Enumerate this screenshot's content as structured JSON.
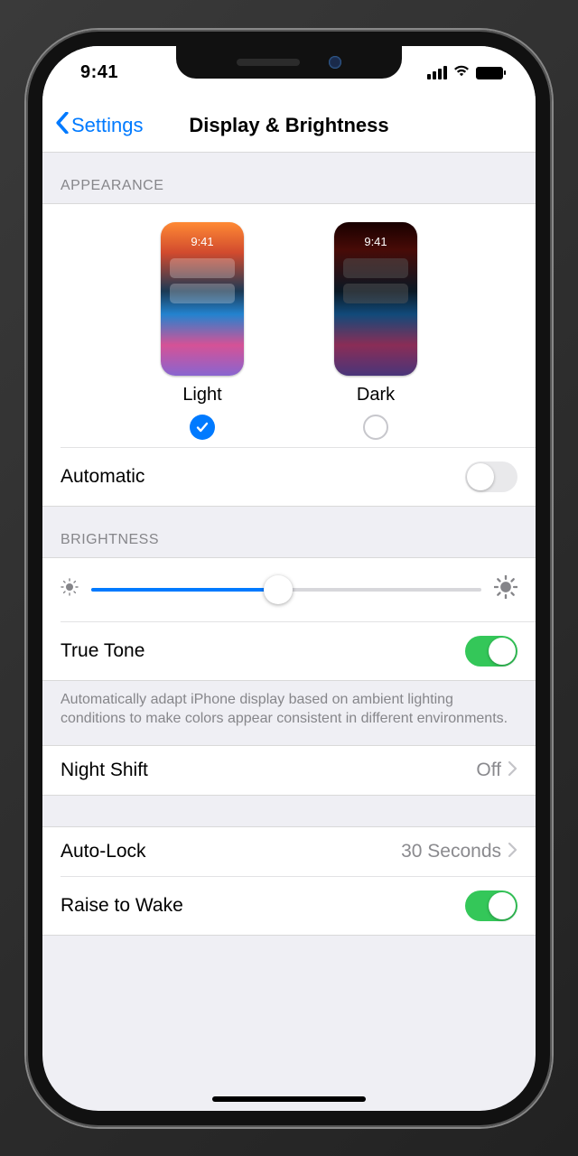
{
  "statusbar": {
    "time": "9:41"
  },
  "nav": {
    "back_label": "Settings",
    "title": "Display & Brightness"
  },
  "appearance": {
    "header": "APPEARANCE",
    "light_label": "Light",
    "dark_label": "Dark",
    "thumb_time": "9:41",
    "selected": "light",
    "automatic_label": "Automatic",
    "automatic_on": false
  },
  "brightness": {
    "header": "BRIGHTNESS",
    "value_pct": 48,
    "truetone_label": "True Tone",
    "truetone_on": true,
    "footnote": "Automatically adapt iPhone display based on ambient lighting conditions to make colors appear consistent in different environments."
  },
  "nightshift": {
    "label": "Night Shift",
    "value": "Off"
  },
  "autolock": {
    "label": "Auto-Lock",
    "value": "30 Seconds"
  },
  "raisewake": {
    "label": "Raise to Wake",
    "on": true
  }
}
